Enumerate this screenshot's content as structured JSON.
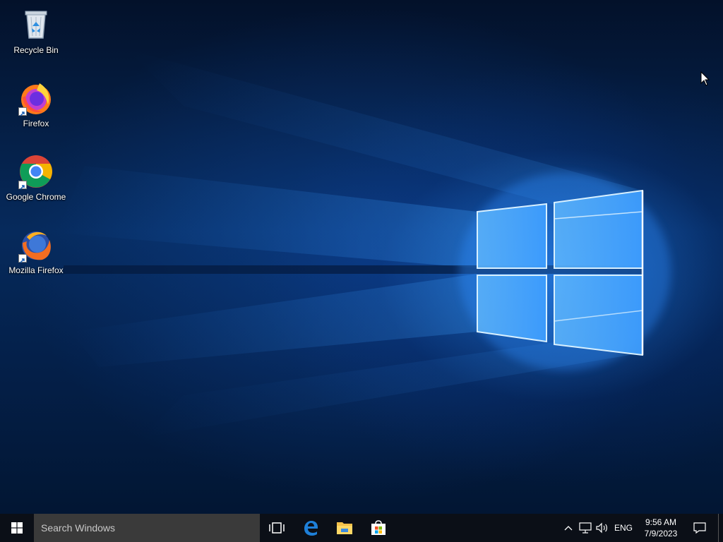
{
  "desktop": {
    "icons": [
      {
        "label": "Recycle Bin",
        "icon": "recycle-bin-icon",
        "shortcut": false
      },
      {
        "label": "Firefox",
        "icon": "firefox-icon",
        "shortcut": true
      },
      {
        "label": "Google Chrome",
        "icon": "chrome-icon",
        "shortcut": true
      },
      {
        "label": "Mozilla Firefox",
        "icon": "firefox-classic-icon",
        "shortcut": true
      }
    ]
  },
  "taskbar": {
    "search_placeholder": "Search Windows",
    "pinned": [
      {
        "name": "task-view",
        "icon": "task-view-icon"
      },
      {
        "name": "edge",
        "icon": "edge-icon"
      },
      {
        "name": "file-explorer",
        "icon": "folder-icon"
      },
      {
        "name": "store",
        "icon": "store-icon"
      }
    ],
    "tray": {
      "language": "ENG",
      "time": "9:56 AM",
      "date": "7/9/2023"
    }
  },
  "colors": {
    "accent": "#0078d7",
    "taskbar_bg": "#0b0f17",
    "search_bg": "#3a3a3a"
  }
}
